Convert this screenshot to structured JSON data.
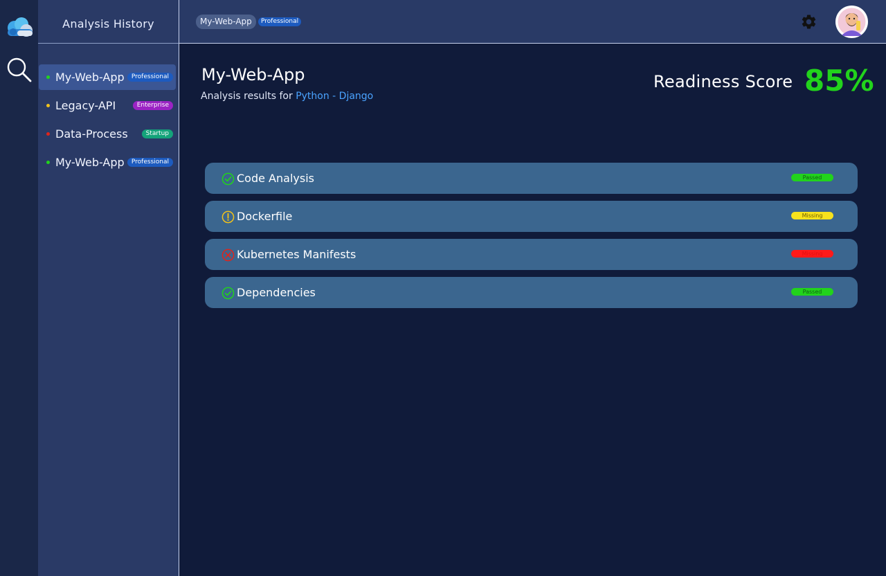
{
  "sidebar": {
    "title": "Analysis History",
    "items": [
      {
        "label": "My-Web-App",
        "badge": "Professional",
        "dot_color": "#22d31c",
        "badge_color": "#1d5bbf",
        "active": true
      },
      {
        "label": "Legacy-API",
        "badge": "Enterprise",
        "dot_color": "#f2c21b",
        "badge_color": "#9b23c4",
        "active": false
      },
      {
        "label": "Data-Process",
        "badge": "Startup",
        "dot_color": "#e0241b",
        "badge_color": "#14a37a",
        "active": false
      },
      {
        "label": "My-Web-App",
        "badge": "Professional",
        "dot_color": "#22d31c",
        "badge_color": "#1d5bbf",
        "active": false
      }
    ]
  },
  "header": {
    "app_name": "My-Web-App",
    "plan_badge": "Professional"
  },
  "main": {
    "title": "My-Web-App",
    "subtitle_prefix": "Analysis results for ",
    "stack": "Python - Django",
    "readiness_label": "Readiness Score",
    "readiness_value": "85%"
  },
  "checks": [
    {
      "label": "Code Analysis",
      "status": "Passed",
      "icon": "check-circle-icon",
      "status_bg": "#22d31c",
      "status_fg": "#0f5e12"
    },
    {
      "label": "Dockerfile",
      "status": "Missing",
      "icon": "warning-circle-icon",
      "status_bg": "#f7e21d",
      "status_fg": "#6b5c00"
    },
    {
      "label": "Kubernetes Manifests",
      "status": "Missing",
      "icon": "error-circle-icon",
      "status_bg": "#ff1a1a",
      "status_fg": "#e01010"
    },
    {
      "label": "Dependencies",
      "status": "Passed",
      "icon": "check-circle-icon",
      "status_bg": "#22d31c",
      "status_fg": "#0f5e12"
    }
  ],
  "colors": {
    "pass": "#22d31c",
    "warn": "#f2c21b",
    "fail": "#e0241b",
    "accent_link": "#4aa3ff"
  }
}
